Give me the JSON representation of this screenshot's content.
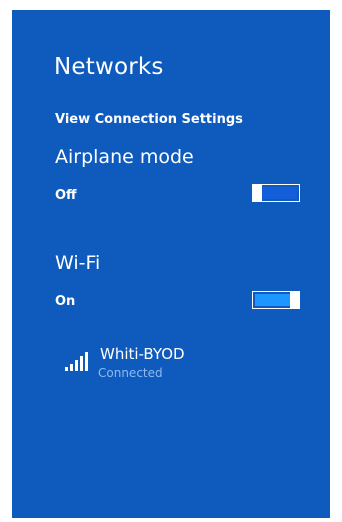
{
  "panel": {
    "title": "Networks",
    "view_settings_link": "View Connection Settings"
  },
  "airplane_mode": {
    "label": "Airplane mode",
    "state": "Off"
  },
  "wifi": {
    "label": "Wi-Fi",
    "state": "On"
  },
  "networks": [
    {
      "name": "Whiti-BYOD",
      "status": "Connected",
      "icon": "signal-bars-icon"
    }
  ],
  "colors": {
    "panel_background": "#0f5bbd",
    "toggle_on_fill": "#1e96ff",
    "status_text": "#8fb9f0"
  }
}
